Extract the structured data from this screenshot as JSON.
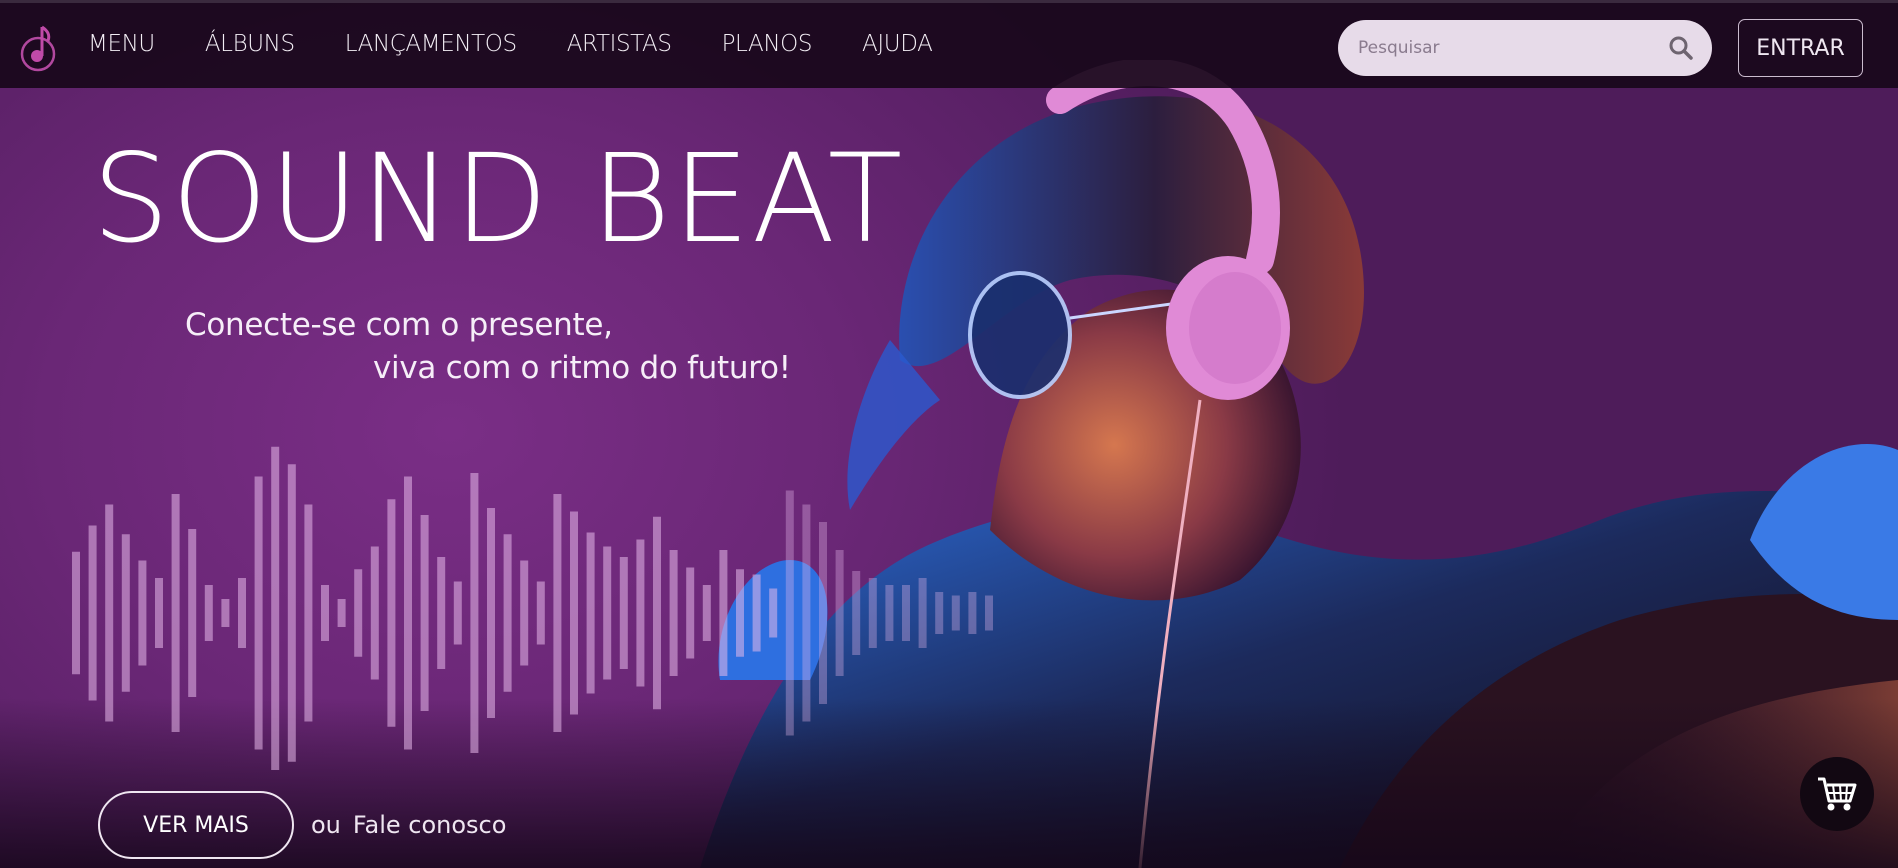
{
  "nav": {
    "items": [
      "MENU",
      "ÁLBUNS",
      "LANÇAMENTOS",
      "ARTISTAS",
      "PLANOS",
      "AJUDA"
    ],
    "search_placeholder": "Pesquisar",
    "login_label": "ENTRAR"
  },
  "hero": {
    "title": "SOUND BEAT",
    "subtitle_line1": "Conecte-se com o presente,",
    "subtitle_line2": "viva com o ritmo do futuro!",
    "cta_label": "VER MAIS",
    "or_text": "ou",
    "contact_link": "Fale conosco"
  },
  "icons": {
    "logo": "music-note-logo",
    "search": "search-icon",
    "cart": "shopping-cart-icon"
  },
  "colors": {
    "background": "#6b2a78",
    "navbar": "#18081a",
    "accent": "#c04aa8",
    "headphones": "#e08ad6"
  }
}
